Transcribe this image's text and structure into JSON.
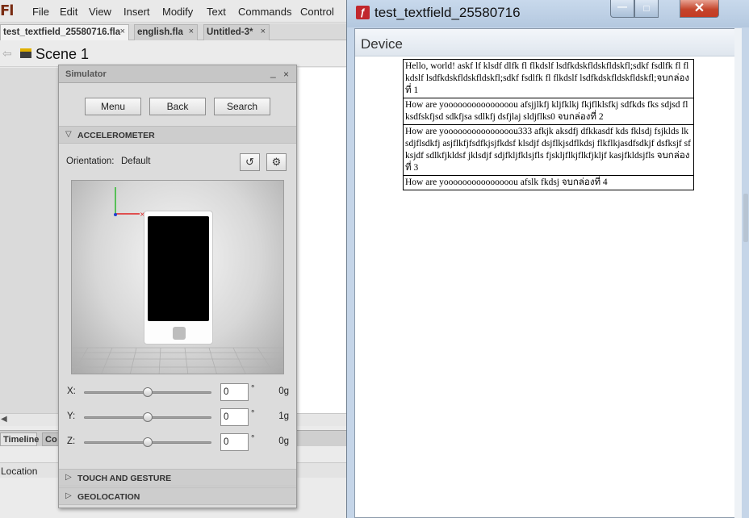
{
  "ide": {
    "app_logo": "Fl",
    "menu": [
      "File",
      "Edit",
      "View",
      "Insert",
      "Modify",
      "Text",
      "Commands",
      "Control"
    ],
    "tabs": [
      {
        "label": "test_textfield_25580716.fla",
        "close": "×"
      },
      {
        "label": "english.fla",
        "close": "×"
      },
      {
        "label": "Untitled-3*",
        "close": "×"
      }
    ],
    "scene": "Scene 1",
    "panel_tabs": [
      "Timeline",
      "Co"
    ],
    "location": "Location"
  },
  "simulator": {
    "title": "Simulator",
    "minimize": "_",
    "close": "×",
    "buttons": [
      "Menu",
      "Back",
      "Search"
    ],
    "accelerometer": {
      "title": "ACCELEROMETER",
      "orientation_label": "Orientation:",
      "orientation_value": "Default",
      "axes": [
        {
          "label": "X:",
          "value": "0",
          "unit": "°",
          "g": "0g",
          "level": 0.5
        },
        {
          "label": "Y:",
          "value": "0",
          "unit": "°",
          "g": "1g",
          "level": 0.5
        },
        {
          "label": "Z:",
          "value": "0",
          "unit": "°",
          "g": "0g",
          "level": 0.5
        }
      ]
    },
    "touch_gesture": "TOUCH AND GESTURE",
    "geolocation": "GEOLOCATION"
  },
  "device_window": {
    "title": "test_textfield_25580716",
    "minimize": "—",
    "close": "✕",
    "header": "Device",
    "textfields": [
      "Hello, world!  askf lf klsdf dlfk fl flkdslf lsdfkdskfldskfldskfl;sdkf fsdlfk fl flkdslf lsdfkdskfldskfldskfl;sdkf fsdlfk fl flkdslf lsdfkdskfldskfldskfl;จบกล่องที่ 1",
      "How are yooooooooooooooou afsjjlkfj  kljfklkj fkjflklsfkj sdfkds fks sdjsd flksdfskfjsd sdkfjsa sdlkfj dsfjlaj sldjflks0 จบกล่องที่ 2",
      "How are yooooooooooooooou333 afkjk aksdfj dfkkasdf kds fklsdj fsjklds lksdjflsdkfj asjflkfjfsdfkjsjfkdsf klsdjf dsjflkjsdflkdsj flkflkjasdfsdkjf dsfksjf sfksjdf sdlkfjkldsf jklsdjf sdjfkljfklsjfls fjskljflkjflkfjkljf kasjfkldsjfls จบกล่องที่ 3",
      "How are yooooooooooooooou afslk fkdsj  จบกล่องที่ 4"
    ]
  }
}
